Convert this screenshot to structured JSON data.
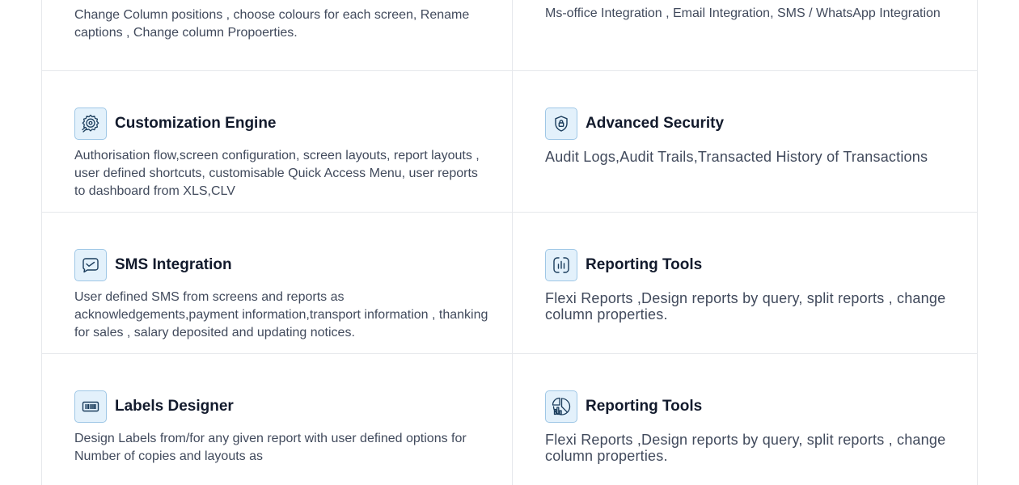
{
  "cards": {
    "top_left": {
      "description": "Change Column positions , choose colours for each screen, Rename captions , Change column Propoerties."
    },
    "top_right": {
      "description": "Ms-office Integration , Email Integration, SMS / WhatsApp Integration"
    },
    "customization": {
      "icon": "gear-settings-icon",
      "title": "Customization Engine",
      "description": "Authorisation flow,screen configuration, screen layouts, report layouts , user defined shortcuts, customisable Quick Access Menu, user reports to dashboard from XLS,CLV"
    },
    "security": {
      "icon": "shield-lock-icon",
      "title": "Advanced Security",
      "description": "Audit Logs,Audit Trails,Transacted History of Transactions"
    },
    "sms": {
      "icon": "message-icon",
      "title": "SMS Integration",
      "description": "User defined SMS from screens and reports as acknowledgements,payment information,transport information , thanking for sales , salary deposited and updating notices."
    },
    "reporting_1": {
      "icon": "bar-chart-icon",
      "title": "Reporting Tools",
      "description": "Flexi Reports ,Design reports by query, split reports , change column properties."
    },
    "labels": {
      "icon": "barcode-icon",
      "title": "Labels Designer",
      "description": "Design Labels from/for any given report with user defined options for Number of copies and layouts as"
    },
    "reporting_2": {
      "icon": "pie-chart-icon",
      "title": "Reporting Tools",
      "description": "Flexi Reports ,Design reports by query, split reports , change column properties."
    }
  },
  "colors": {
    "icon_bg": "#e3f1fb",
    "icon_border": "#9fc7e6",
    "icon_stroke": "#1b3d5c",
    "title": "#121a2c",
    "text": "#414a5c",
    "divider": "#e6e8ec"
  }
}
